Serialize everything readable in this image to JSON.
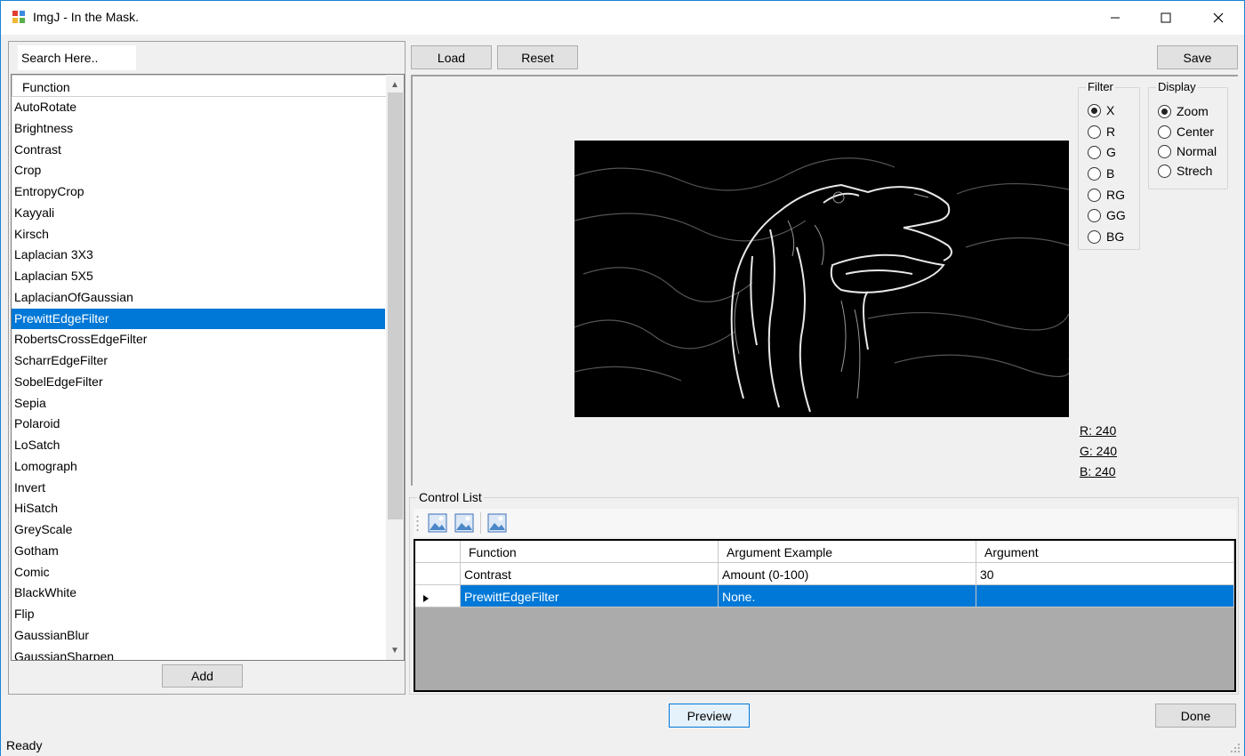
{
  "window": {
    "title": "ImgJ - In the Mask.",
    "minimize_icon": "minimize-icon",
    "maximize_icon": "maximize-icon",
    "close_icon": "close-icon"
  },
  "search": {
    "placeholder": "Search Here.."
  },
  "function_list": {
    "header": "Function",
    "items": [
      "AutoRotate",
      "Brightness",
      "Contrast",
      "Crop",
      "EntropyCrop",
      "Kayyali",
      "Kirsch",
      "Laplacian 3X3",
      "Laplacian 5X5",
      "LaplacianOfGaussian",
      "PrewittEdgeFilter",
      "RobertsCrossEdgeFilter",
      "ScharrEdgeFilter",
      "SobelEdgeFilter",
      "Sepia",
      "Polaroid",
      "LoSatch",
      "Lomograph",
      "Invert",
      "HiSatch",
      "GreyScale",
      "Gotham",
      "Comic",
      "BlackWhite",
      "Flip",
      "GaussianBlur",
      "GaussianSharpen"
    ],
    "selected": "PrewittEdgeFilter"
  },
  "buttons": {
    "add": "Add",
    "load": "Load",
    "reset": "Reset",
    "save": "Save",
    "preview": "Preview",
    "done": "Done"
  },
  "filter": {
    "legend": "Filter",
    "options": [
      "X",
      "R",
      "G",
      "B",
      "RG",
      "GG",
      "BG"
    ],
    "selected": "X"
  },
  "display": {
    "legend": "Display",
    "options": [
      "Zoom",
      "Center",
      "Normal",
      "Strech"
    ],
    "selected": "Zoom"
  },
  "pixel": {
    "r": "R: 240",
    "g": "G: 240",
    "b": "B: 240"
  },
  "control_list": {
    "legend": "Control List",
    "toolbar_icons": [
      "image-add-icon",
      "image-remove-icon",
      "image-icon"
    ],
    "columns": [
      "Function",
      "Argument Example",
      "Argument"
    ],
    "rows": [
      {
        "function": "Contrast",
        "example": "Amount (0-100)",
        "argument": "30"
      },
      {
        "function": "PrewittEdgeFilter",
        "example": "None.",
        "argument": ""
      }
    ],
    "selected_row": 1
  },
  "status": {
    "text": "Ready"
  }
}
